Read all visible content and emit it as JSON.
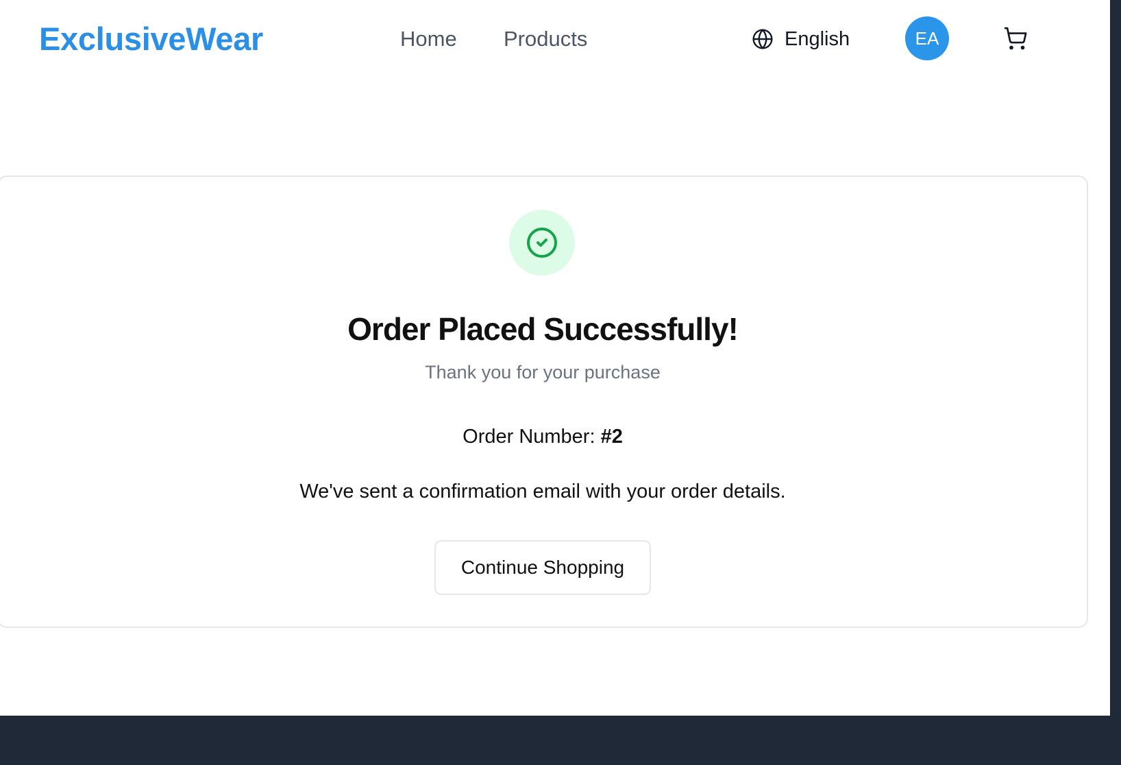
{
  "header": {
    "logo": "ExclusiveWear",
    "nav": [
      {
        "label": "Home"
      },
      {
        "label": "Products"
      }
    ],
    "language": {
      "label": "English",
      "icon": "globe-icon"
    },
    "avatar": {
      "initials": "EA",
      "color": "#2b95ea"
    },
    "cart": {
      "icon": "cart-icon"
    }
  },
  "confirmation": {
    "icon": "check-circle-icon",
    "title": "Order Placed Successfully!",
    "subtitle": "Thank you for your purchase",
    "order_number_label": "Order Number:",
    "order_number": "#2",
    "email_note": "We've sent a confirmation email with your order details.",
    "continue_label": "Continue Shopping"
  },
  "colors": {
    "brand": "#2b8fe6",
    "success": "#16a34a",
    "success_bg": "#dcfce7",
    "footer": "#1f2937"
  }
}
